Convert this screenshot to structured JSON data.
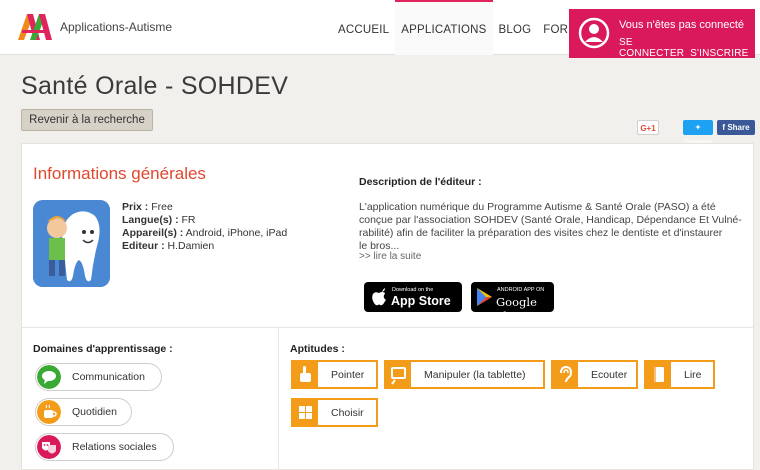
{
  "header": {
    "site_name": "Applications-Autisme",
    "nav": [
      "ACCUEIL",
      "APPLICATIONS",
      "BLOG",
      "FORUM"
    ],
    "active_nav": "APPLICATIONS",
    "login": {
      "status": "Vous n'êtes pas connecté",
      "connect": "SE CONNECTER",
      "register": "S'INSCRIRE"
    }
  },
  "page": {
    "title": "Santé Orale - SOHDEV",
    "back_label": "Revenir à la recherche"
  },
  "share": {
    "gplus": "G+1",
    "tweet": "Tweeter",
    "facebook": "Share"
  },
  "info": {
    "section_title": "Informations générales",
    "price_label": "Prix :",
    "price": "Free",
    "language_label": "Langue(s) :",
    "language": "FR",
    "devices_label": "Appareil(s) :",
    "devices": "Android, iPhone, iPad",
    "publisher_label": "Editeur :",
    "publisher": "H.Damien"
  },
  "description": {
    "title": "Description de l'éditeur :",
    "lines": [
      "L'application numérique du Programme Autisme & Santé Orale (PASO) a été",
      "conçue par l'association SOHDEV (Santé Orale, Handicap, Dépendance Et Vulné-",
      "rabilité) afin de faciliter la préparation des visites chez le dentiste et d'instaurer",
      "le bros..."
    ],
    "read_more": ">> lire la suite"
  },
  "stores": {
    "apple_small": "Download on the",
    "apple_big": "App Store",
    "google_small": "ANDROID APP ON",
    "google_big": "Google play"
  },
  "domains": {
    "title": "Domaines d'apprentissage :",
    "items": [
      {
        "label": "Communication",
        "color": "#3aaa35"
      },
      {
        "label": "Quotidien",
        "color": "#f39c1a"
      },
      {
        "label": "Relations sociales",
        "color": "#d9195b"
      }
    ]
  },
  "aptitudes": {
    "title": "Aptitudes :",
    "items": [
      {
        "label": "Pointer",
        "icon": "hand-icon"
      },
      {
        "label": "Manipuler (la tablette)",
        "icon": "tablet-icon"
      },
      {
        "label": "Ecouter",
        "icon": "ear-icon"
      },
      {
        "label": "Lire",
        "icon": "book-icon"
      },
      {
        "label": "Choisir",
        "icon": "grid-icon"
      }
    ]
  },
  "colors": {
    "brand": "#d9195b",
    "accent": "#e0482e",
    "aptitude": "#f39c1a"
  }
}
